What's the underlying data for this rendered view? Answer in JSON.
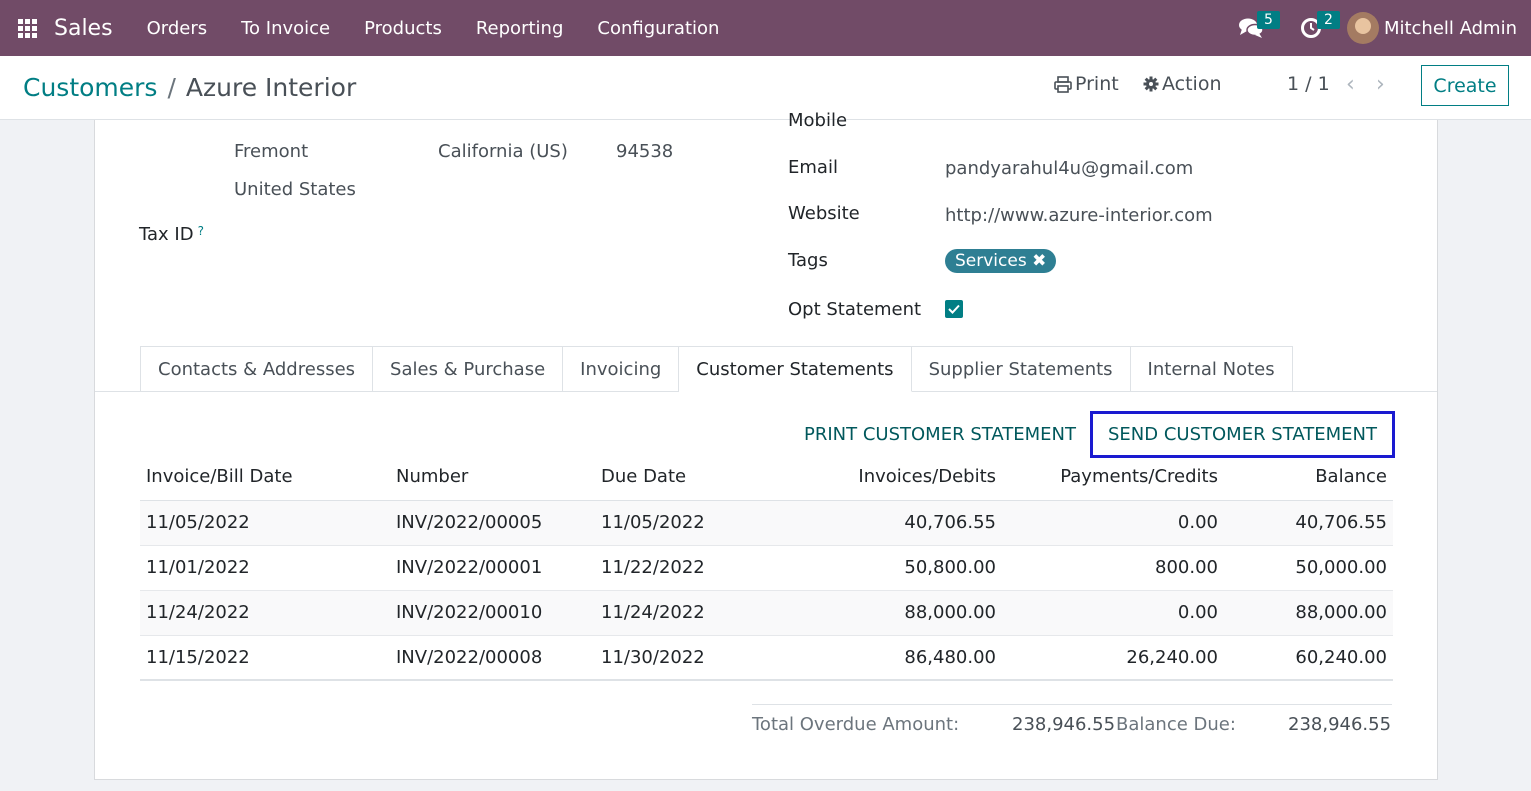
{
  "navbar": {
    "app_name": "Sales",
    "menu": [
      "Orders",
      "To Invoice",
      "Products",
      "Reporting",
      "Configuration"
    ],
    "messages_count": "5",
    "activities_count": "2",
    "user_name": "Mitchell Admin",
    "icons": [
      "apps-grid-icon",
      "chat-icon",
      "clock-icon"
    ]
  },
  "control_panel": {
    "breadcrumb_parent": "Customers",
    "breadcrumb_separator": "/",
    "breadcrumb_current": "Azure Interior",
    "print_label": "Print",
    "action_label": "Action",
    "pager": "1 / 1",
    "create_label": "Create"
  },
  "address": {
    "city": "Fremont",
    "state": "California (US)",
    "zip": "94538",
    "country": "United States",
    "tax_id_label": "Tax ID",
    "tax_id_help": "?"
  },
  "contact": {
    "mobile_label": "Mobile",
    "email_label": "Email",
    "email_value": "pandyarahul4u@gmail.com",
    "website_label": "Website",
    "website_value": "http://www.azure-interior.com",
    "tags_label": "Tags",
    "tag_services": "Services",
    "opt_statement_label": "Opt Statement",
    "opt_statement_checked": true
  },
  "tabs": [
    "Contacts & Addresses",
    "Sales & Purchase",
    "Invoicing",
    "Customer Statements",
    "Supplier Statements",
    "Internal Notes"
  ],
  "active_tab": "Customer Statements",
  "statement": {
    "print_label": "PRINT CUSTOMER STATEMENT",
    "send_label": "SEND CUSTOMER STATEMENT",
    "columns": [
      "Invoice/Bill Date",
      "Number",
      "Due Date",
      "Invoices/Debits",
      "Payments/Credits",
      "Balance"
    ],
    "rows": [
      [
        "11/05/2022",
        "INV/2022/00005",
        "11/05/2022",
        "40,706.55",
        "0.00",
        "40,706.55"
      ],
      [
        "11/01/2022",
        "INV/2022/00001",
        "11/22/2022",
        "50,800.00",
        "800.00",
        "50,000.00"
      ],
      [
        "11/24/2022",
        "INV/2022/00010",
        "11/24/2022",
        "88,000.00",
        "0.00",
        "88,000.00"
      ],
      [
        "11/15/2022",
        "INV/2022/00008",
        "11/30/2022",
        "86,480.00",
        "26,240.00",
        "60,240.00"
      ]
    ],
    "total_overdue_label": "Total Overdue Amount:",
    "total_overdue_value": "238,946.55",
    "balance_due_label": "Balance Due:",
    "balance_due_value": "238,946.55"
  },
  "colors": {
    "navbar": "#714b67",
    "accent": "#017e84",
    "highlight_border": "#1a1ad0"
  }
}
